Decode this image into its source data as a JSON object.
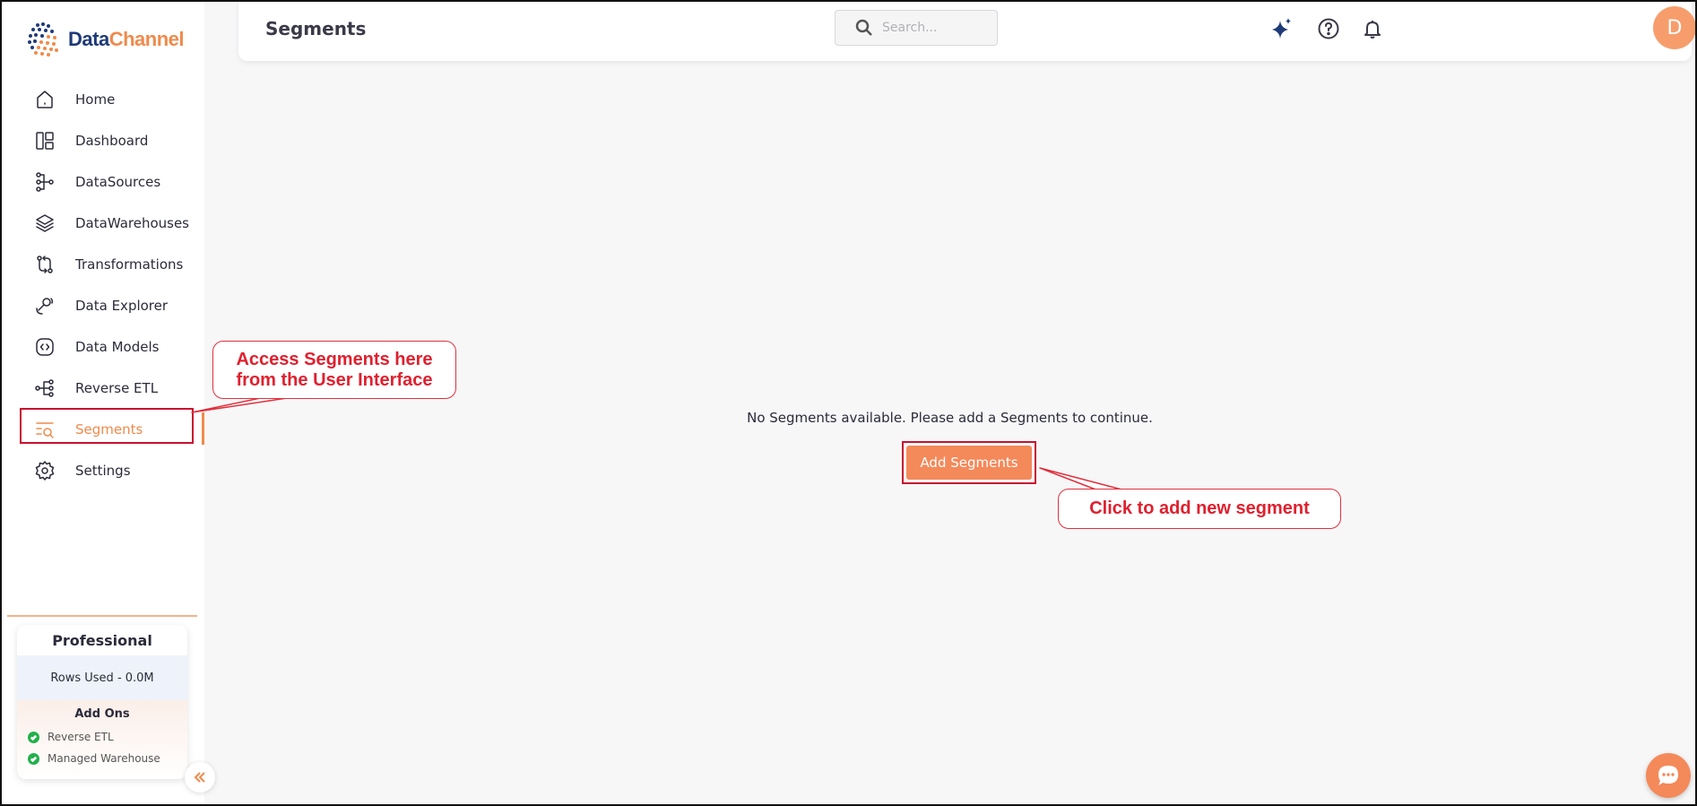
{
  "app": {
    "logo_text_a": "Data",
    "logo_text_b": "Channel",
    "brand_color": "#f08a4b",
    "brand_navy": "#1f3a78"
  },
  "sidebar": {
    "items": [
      {
        "label": "Home",
        "icon": "home-icon"
      },
      {
        "label": "Dashboard",
        "icon": "dashboard-icon"
      },
      {
        "label": "DataSources",
        "icon": "datasources-icon"
      },
      {
        "label": "DataWarehouses",
        "icon": "layers-icon"
      },
      {
        "label": "Transformations",
        "icon": "transform-icon"
      },
      {
        "label": "Data Explorer",
        "icon": "explorer-icon"
      },
      {
        "label": "Data Models",
        "icon": "code-icon"
      },
      {
        "label": "Reverse ETL",
        "icon": "reverse-etl-icon"
      },
      {
        "label": "Segments",
        "icon": "segments-icon",
        "active": true
      },
      {
        "label": "Settings",
        "icon": "gear-icon"
      }
    ],
    "plan": {
      "title": "Professional",
      "rows_used": "Rows Used - 0.0M",
      "addons_title": "Add Ons",
      "addons": [
        "Reverse ETL",
        "Managed Warehouse"
      ]
    }
  },
  "header": {
    "title": "Segments",
    "search_placeholder": "Search..."
  },
  "user": {
    "avatar_initial": "D",
    "avatar_color": "#f79d6c"
  },
  "main": {
    "empty_message": "No Segments available. Please add a Segments to continue.",
    "add_button": "Add Segments"
  },
  "annotations": {
    "callout1_line1": "Access Segments here",
    "callout1_line2": "from the User Interface",
    "callout2": "Click to add new segment",
    "highlight_color": "#c8102e"
  }
}
